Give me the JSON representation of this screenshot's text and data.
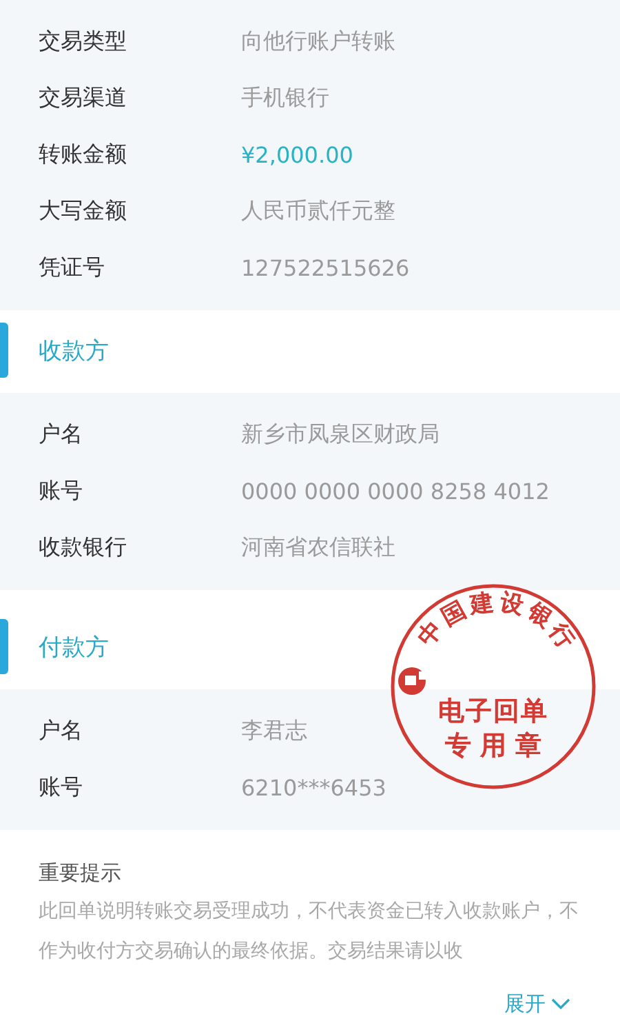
{
  "transaction": {
    "rows": [
      {
        "label": "交易类型",
        "value": "向他行账户转账",
        "kind": "plain"
      },
      {
        "label": "交易渠道",
        "value": "手机银行",
        "kind": "plain"
      },
      {
        "label": "转账金额",
        "value": "¥2,000.00",
        "kind": "amount"
      },
      {
        "label": "大写金额",
        "value": "人民币贰仟元整",
        "kind": "plain"
      },
      {
        "label": "凭证号",
        "value": "127522515626",
        "kind": "plain"
      }
    ]
  },
  "payee": {
    "title": "收款方",
    "rows": [
      {
        "label": "户名",
        "value": "新乡市凤泉区财政局"
      },
      {
        "label": "账号",
        "value": "0000 0000 0000 8258 4012"
      },
      {
        "label": "收款银行",
        "value": "河南省农信联社"
      }
    ]
  },
  "payer": {
    "title": "付款方",
    "rows": [
      {
        "label": "户名",
        "value": "李君志"
      },
      {
        "label": "账号",
        "value": "6210***6453"
      }
    ]
  },
  "seal": {
    "arc_text": "中国建设银行",
    "line_1": "电子回单",
    "line_2": "专 用 章"
  },
  "notice": {
    "title": "重要提示",
    "text": "此回单说明转账交易受理成功，不代表资金已转入收款账户，不作为收付方交易确认的最终依据。交易结果请以收",
    "expand_label": "展开"
  }
}
